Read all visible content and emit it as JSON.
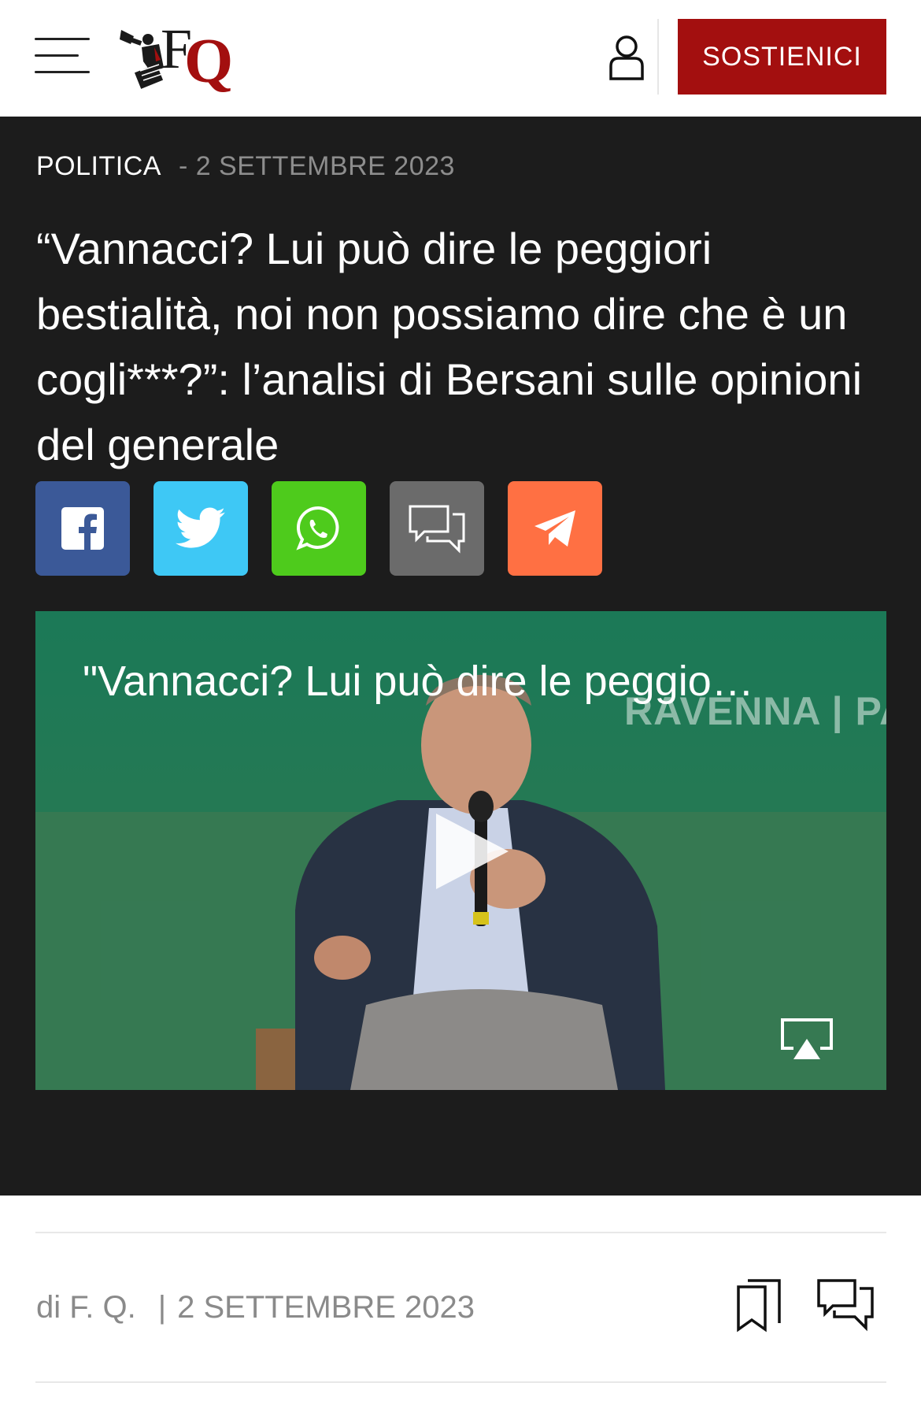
{
  "header": {
    "menu_icon": "hamburger-menu-icon",
    "logo_text": "FQ",
    "user_icon": "user-icon",
    "support_label": "SOSTIENICI"
  },
  "article": {
    "category": "POLITICA",
    "date": "- 2 SETTEMBRE 2023",
    "headline": "“Vannacci? Lui può dire le peggiori bestialità, noi non possiamo dire che è un cogli***?”: l’analisi di Bersani sulle opinioni del generale"
  },
  "share": [
    {
      "name": "facebook",
      "icon": "facebook-icon",
      "color": "#3b5998"
    },
    {
      "name": "twitter",
      "icon": "twitter-icon",
      "color": "#3ec8f5"
    },
    {
      "name": "whatsapp",
      "icon": "whatsapp-icon",
      "color": "#4ecb1c"
    },
    {
      "name": "comments",
      "icon": "comment-icon",
      "color": "#6b6b6b"
    },
    {
      "name": "telegram",
      "icon": "telegram-icon",
      "color": "#ff7043"
    }
  ],
  "video": {
    "title": "\"Vannacci? Lui può dire le peggio…",
    "watermark": "RAVENNA | PA",
    "play_icon": "play-icon",
    "airplay_icon": "airplay-icon"
  },
  "byline": {
    "author": "di F. Q.",
    "separator": "|",
    "date": "2 SETTEMBRE 2023",
    "bookmark_icon": "bookmark-icon",
    "comments_icon": "comments-icon"
  },
  "colors": {
    "brand_red": "#a30f0f",
    "hero_bg": "#1c1c1c"
  }
}
